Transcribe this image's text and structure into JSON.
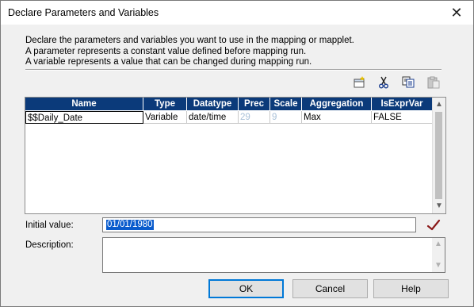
{
  "window": {
    "title": "Declare Parameters and Variables",
    "close_glyph": "✕"
  },
  "description_lines": [
    "Declare the parameters and variables you want to use in the mapping or mapplet.",
    "A parameter represents a constant value defined before mapping run.",
    "A variable represents a value that can be changed during mapping run."
  ],
  "toolbar": {
    "icons": [
      "new-icon",
      "cut-icon",
      "copy-icon",
      "paste-icon"
    ]
  },
  "table": {
    "columns": [
      "Name",
      "Type",
      "Datatype",
      "Prec",
      "Scale",
      "Aggregation",
      "IsExprVar"
    ],
    "rows": [
      [
        "$$Daily_Date",
        "Variable",
        "date/time",
        "29",
        "9",
        "Max",
        "FALSE"
      ]
    ]
  },
  "initial_value": {
    "label": "Initial value:",
    "value": "01/01/1980"
  },
  "description": {
    "label": "Description:",
    "value": ""
  },
  "buttons": {
    "ok": "OK",
    "cancel": "Cancel",
    "help": "Help"
  },
  "colors": {
    "header_bg": "#0b3a7a",
    "selection": "#0a5ccd",
    "accent": "#0078d7",
    "check": "#8b1a1a"
  }
}
